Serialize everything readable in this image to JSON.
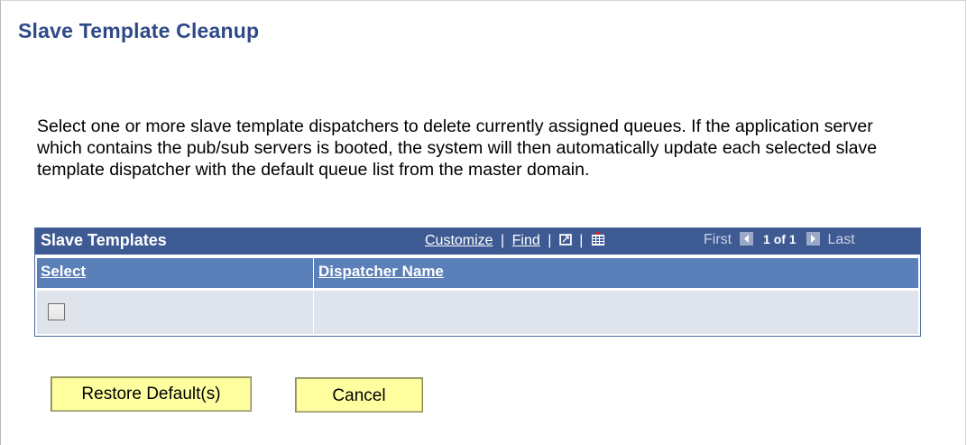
{
  "page": {
    "title": "Slave Template Cleanup",
    "instructions": "Select one or more slave template dispatchers to delete currently assigned queues.  If the application server which contains the pub/sub servers is booted, the system will then automatically update each selected slave template dispatcher with the default queue list from the master domain."
  },
  "grid": {
    "title": "Slave Templates",
    "customize_label": "Customize",
    "find_label": "Find",
    "separator": "|",
    "zoom_icon": "zoom-grid-icon",
    "download_icon": "download-to-excel-icon",
    "nav": {
      "first_label": "First",
      "count_label": "1 of 1",
      "last_label": "Last"
    },
    "columns": {
      "select": "Select",
      "dispatcher_name": "Dispatcher Name"
    },
    "rows": [
      {
        "selected": false,
        "dispatcher_name": ""
      }
    ]
  },
  "buttons": {
    "restore_label": "Restore Default(s)",
    "cancel_label": "Cancel"
  },
  "colors": {
    "title": "#2f4a88",
    "grid_header": "#3e5a93",
    "column_header": "#5a7fb9",
    "row_background": "#dfe3ec",
    "button_background": "#ffffa0"
  }
}
